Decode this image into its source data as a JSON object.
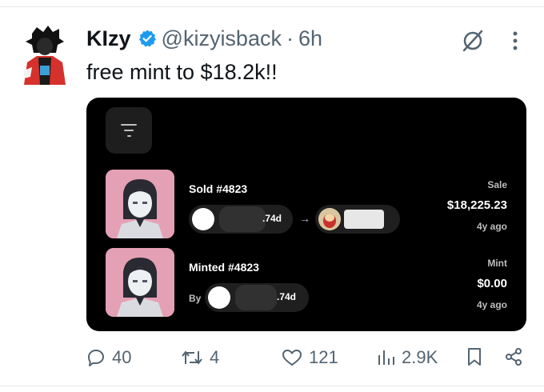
{
  "tweet": {
    "display_name": "KIzy",
    "handle": "@kizyisback",
    "separator": "·",
    "time": "6h",
    "text": "free mint to $18.2k!!"
  },
  "card": {
    "events": [
      {
        "title": "Sold #4823",
        "from_suffix": ".74d",
        "arrow": "→",
        "right_label": "Sale",
        "right_value": "$18,225.23",
        "right_time": "4y ago"
      },
      {
        "title": "Minted #4823",
        "by_label": "By",
        "from_suffix": ".74d",
        "right_label": "Mint",
        "right_value": "$0.00",
        "right_time": "4y ago"
      }
    ]
  },
  "actions": {
    "replies": "40",
    "reposts": "4",
    "likes": "121",
    "views": "2.9K"
  },
  "colors": {
    "verified": "#1d9bf0",
    "text_secondary": "#536471",
    "card_bg": "#000000",
    "nft_bg": "#e4a0b4"
  }
}
